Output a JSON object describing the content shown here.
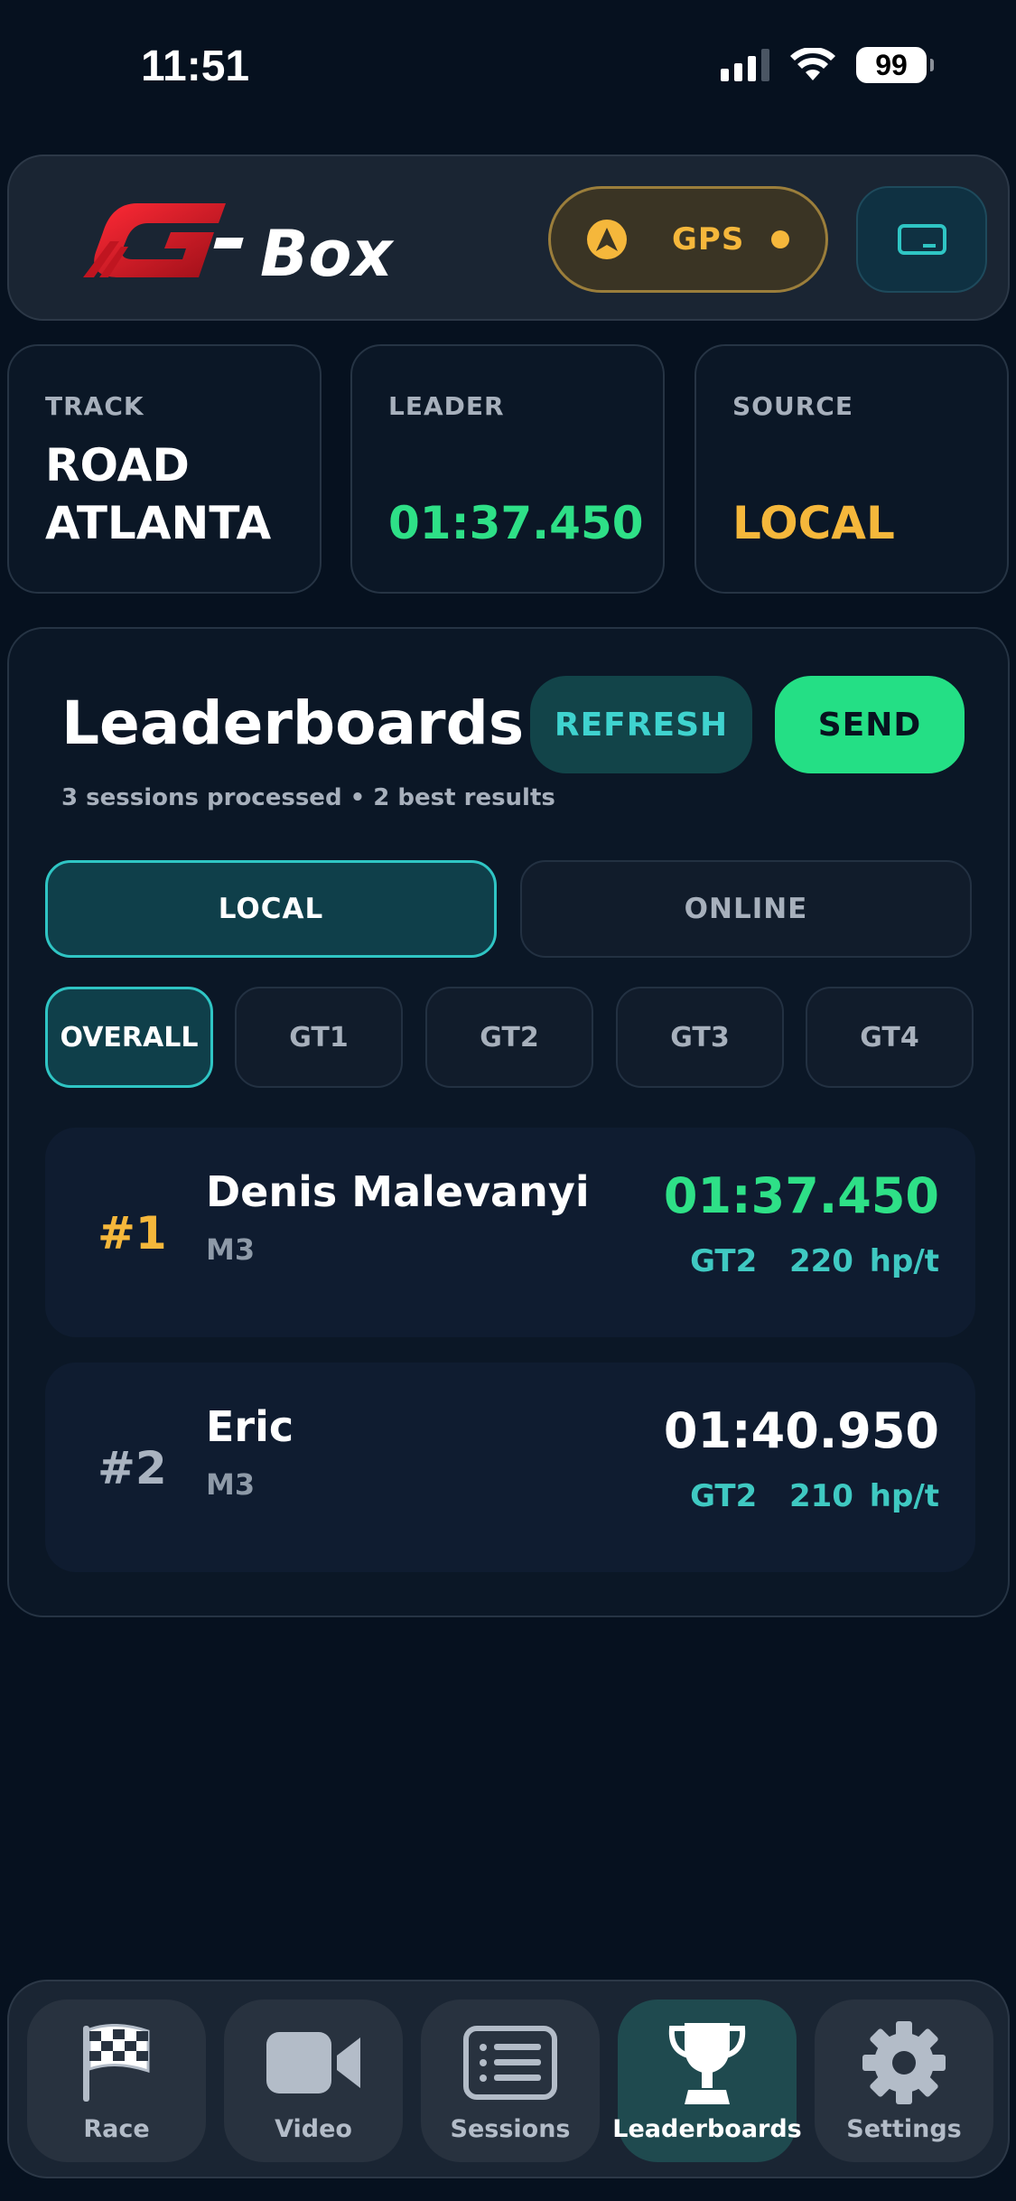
{
  "status_bar": {
    "time": "11:51",
    "battery": "99"
  },
  "header": {
    "logo_text": "G-Box",
    "gps_label": "GPS",
    "device_button_icon": "card-icon"
  },
  "stats": {
    "track": {
      "label": "TRACK",
      "value_line1": "ROAD",
      "value_line2": "ATLANTA"
    },
    "leader": {
      "label": "LEADER",
      "value": "01:37.450"
    },
    "source": {
      "label": "SOURCE",
      "value": "LOCAL"
    }
  },
  "leaderboards": {
    "title": "Leaderboards",
    "subtitle": "3 sessions processed • 2 best results",
    "refresh_label": "REFRESH",
    "send_label": "SEND",
    "segments": [
      "LOCAL",
      "ONLINE"
    ],
    "active_segment": "LOCAL",
    "classes": [
      "OVERALL",
      "GT1",
      "GT2",
      "GT3",
      "GT4"
    ],
    "active_class": "OVERALL",
    "entries": [
      {
        "rank": "#1",
        "name": "Denis Malevanyi",
        "car": "M3",
        "time": "01:37.450",
        "class": "GT2",
        "power": "220 hp/t"
      },
      {
        "rank": "#2",
        "name": "Eric",
        "car": "M3",
        "time": "01:40.950",
        "class": "GT2",
        "power": "210 hp/t"
      }
    ]
  },
  "tabs": [
    {
      "label": "Race",
      "icon": "checkered-flag-icon"
    },
    {
      "label": "Video",
      "icon": "video-camera-icon"
    },
    {
      "label": "Sessions",
      "icon": "list-icon"
    },
    {
      "label": "Leaderboards",
      "icon": "trophy-icon"
    },
    {
      "label": "Settings",
      "icon": "gear-icon"
    }
  ],
  "active_tab": "Leaderboards",
  "colors": {
    "background": "#06111f",
    "accent_green": "#2ee087",
    "accent_amber": "#f5b73b",
    "accent_teal": "#2fc5c4",
    "logo_red": "#e11d2a"
  }
}
